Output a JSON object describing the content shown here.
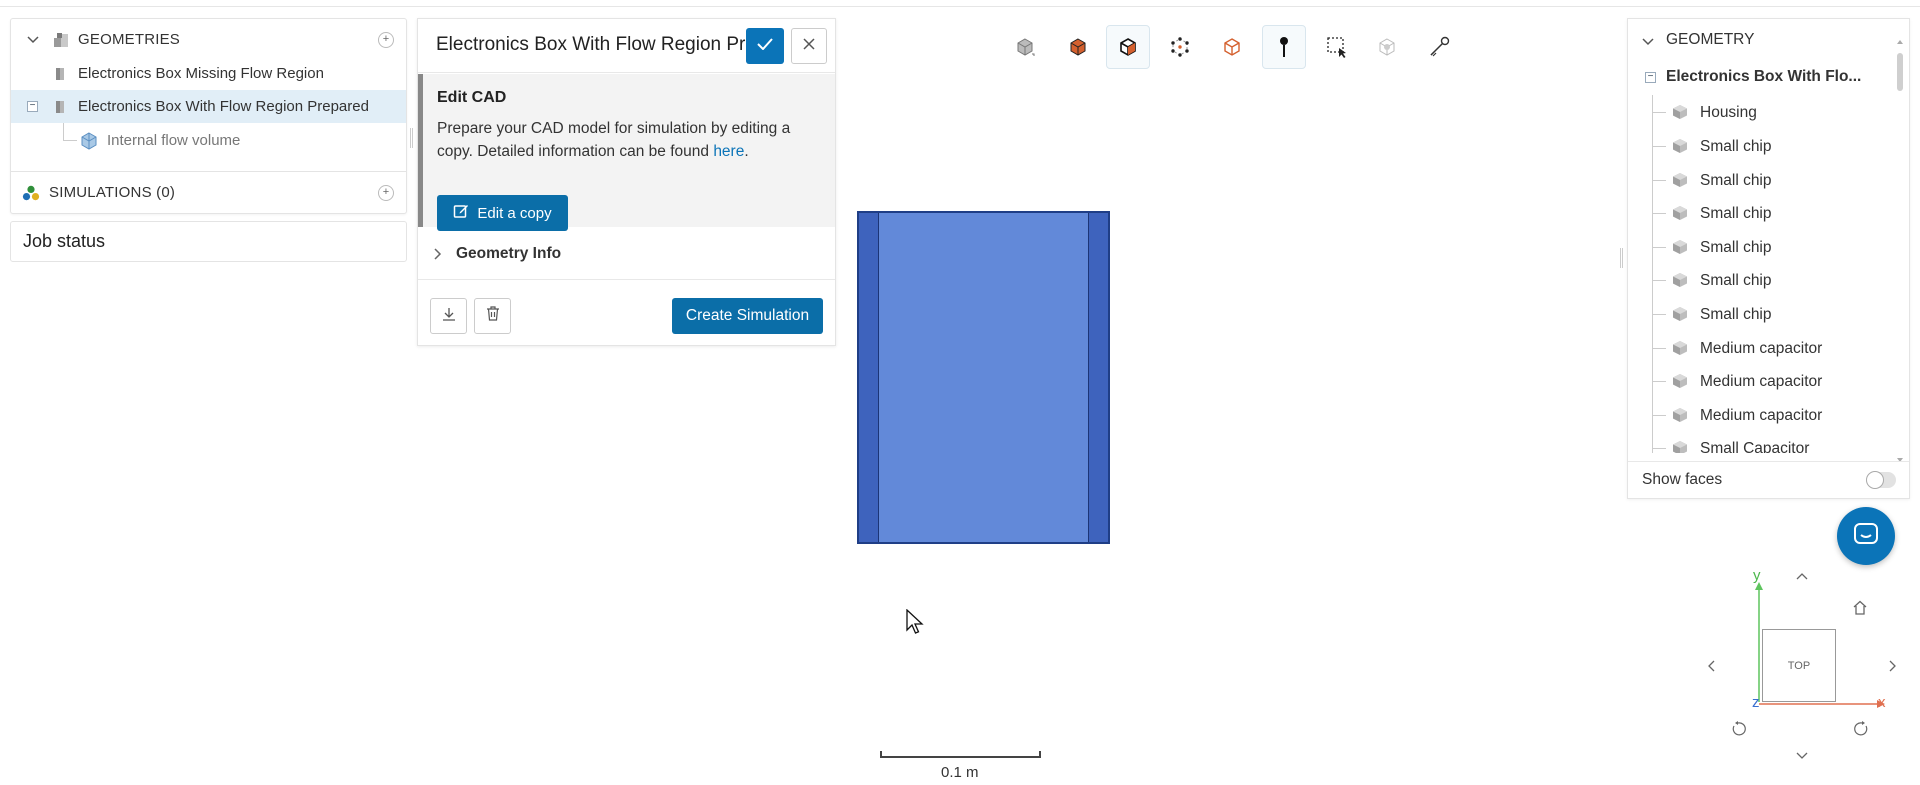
{
  "tree": {
    "geometries_title": "GEOMETRIES",
    "items": [
      {
        "label": "Electronics Box Missing Flow Region"
      },
      {
        "label": "Electronics Box With Flow Region Prepared"
      },
      {
        "label": "Internal flow volume"
      }
    ],
    "simulations_title": "SIMULATIONS (0)"
  },
  "job_status": {
    "title": "Job status"
  },
  "edit_panel": {
    "title": "Electronics Box With Flow Region Prepared",
    "section_title": "Edit CAD",
    "description": "Prepare your CAD model for simulation by editing a copy. Detailed information can be found ",
    "link_text": "here",
    "description_end": ".",
    "edit_copy_label": "Edit a copy",
    "geometry_info_label": "Geometry Info",
    "create_simulation_label": "Create Simulation"
  },
  "toolbar": {
    "tools": [
      "cube-view-icon",
      "solid-view-icon",
      "solid-edges-icon",
      "points-view-icon",
      "wireframe-icon",
      "pin-icon",
      "box-select-icon",
      "hide-icon",
      "measure-icon"
    ]
  },
  "viewport": {
    "scale_label": "0.1 m",
    "nav_cube_label": "TOP",
    "axis_x": "x",
    "axis_y": "y",
    "axis_z": "z"
  },
  "geometry_panel": {
    "title": "GEOMETRY",
    "root": "Electronics Box With Flo...",
    "items": [
      "Housing",
      "Small chip",
      "Small chip",
      "Small chip",
      "Small chip",
      "Small chip",
      "Small chip",
      "Medium capacitor",
      "Medium capacitor",
      "Medium capacitor",
      "Small Capacitor"
    ],
    "show_faces_label": "Show faces"
  },
  "colors": {
    "accent": "#0b6ea8",
    "model_fill": "#6289d9",
    "model_side": "#3e63bd",
    "selected_row": "#e1eef7"
  }
}
